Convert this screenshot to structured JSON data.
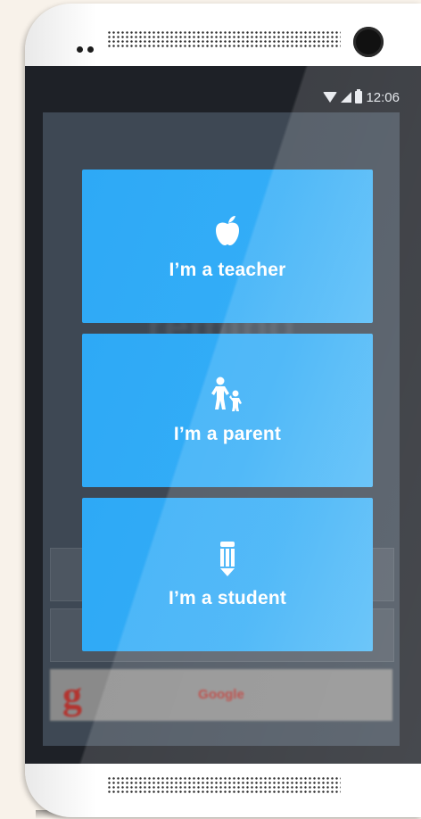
{
  "status_bar": {
    "time": "12:06",
    "icons": [
      "wifi-icon",
      "signal-icon",
      "battery-icon"
    ]
  },
  "background_app": {
    "brand": "remind",
    "tagline": "",
    "google_button_label": "Google",
    "google_logo_letter": "g"
  },
  "role_selector": {
    "options": [
      {
        "label": "I’m a teacher",
        "icon": "apple-icon"
      },
      {
        "label": "I’m a parent",
        "icon": "parent-child-icon"
      },
      {
        "label": "I’m a student",
        "icon": "pencil-icon"
      }
    ]
  },
  "colors": {
    "card_blue": "#33adf7",
    "overlay_dark": "#1e2127",
    "phone_body": "#ffffff"
  }
}
